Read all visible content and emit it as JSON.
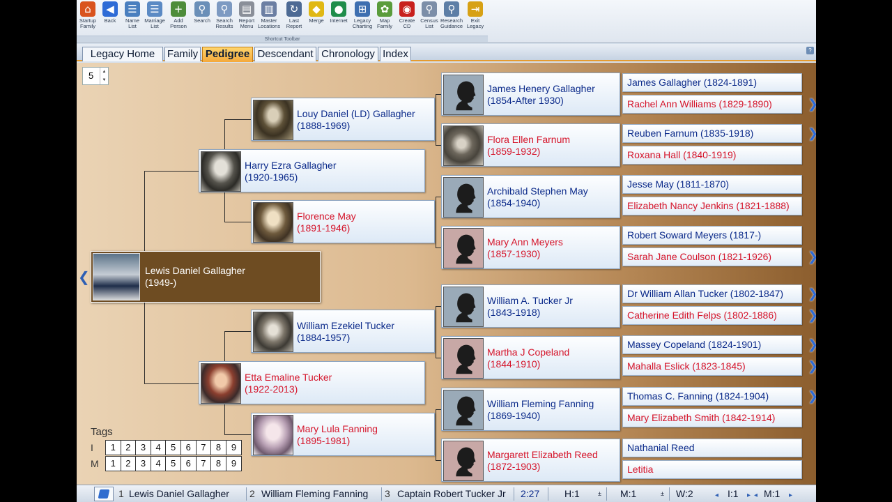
{
  "toolbar": {
    "caption": "Shortcut Toolbar",
    "tools": [
      {
        "label": "Startup\nFamily",
        "icon": "house-icon",
        "glyph": "⌂",
        "color": "#d9531e"
      },
      {
        "label": "Back",
        "icon": "back-arrow-icon",
        "glyph": "◀",
        "color": "#2e6bd6"
      },
      {
        "label": "Name\nList",
        "icon": "name-list-icon",
        "glyph": "☰",
        "color": "#4a7fbf"
      },
      {
        "label": "Marriage\nList",
        "icon": "marriage-list-icon",
        "glyph": "☰",
        "color": "#5b8ac4"
      },
      {
        "label": "Add\nPerson",
        "icon": "add-person-icon",
        "glyph": "+",
        "color": "#4d8c3a"
      },
      {
        "label": "Search",
        "icon": "search-icon",
        "glyph": "⚲",
        "color": "#6a8fb8"
      },
      {
        "label": "Search\nResults",
        "icon": "search-results-icon",
        "glyph": "⚲",
        "color": "#7d9ac2"
      },
      {
        "label": "Report\nMenu",
        "icon": "report-menu-icon",
        "glyph": "▤",
        "color": "#8a8f99"
      },
      {
        "label": "Master\nLocations",
        "icon": "master-locations-icon",
        "glyph": "▥",
        "color": "#6c7fa3"
      },
      {
        "label": "Last\nReport",
        "icon": "last-report-icon",
        "glyph": "↻",
        "color": "#4d6a94"
      },
      {
        "label": "Merge",
        "icon": "merge-icon",
        "glyph": "◆",
        "color": "#e0b814"
      },
      {
        "label": "Internet",
        "icon": "globe-icon",
        "glyph": "●",
        "color": "#1f8d4b"
      },
      {
        "label": "Legacy\nCharting",
        "icon": "charting-icon",
        "glyph": "⊞",
        "color": "#3e6fb0"
      },
      {
        "label": "Map\nFamily",
        "icon": "map-family-icon",
        "glyph": "✿",
        "color": "#5a9c3c"
      },
      {
        "label": "Create\nCD",
        "icon": "create-cd-icon",
        "glyph": "◉",
        "color": "#c8201e"
      },
      {
        "label": "Census\nList",
        "icon": "census-list-icon",
        "glyph": "⚲",
        "color": "#7c8ea8"
      },
      {
        "label": "Research\nGuidance",
        "icon": "research-guidance-icon",
        "glyph": "⚲",
        "color": "#5d7ea6"
      },
      {
        "label": "Exit\nLegacy",
        "icon": "exit-icon",
        "glyph": "⇥",
        "color": "#d7a115"
      }
    ]
  },
  "tabs": [
    "Legacy Home",
    "Family",
    "Pedigree",
    "Descendant",
    "Chronology",
    "Index"
  ],
  "active_tab": "Pedigree",
  "generations": "5",
  "root": {
    "name": "Lewis Daniel Gallagher",
    "dates": "(1949-)"
  },
  "parents": [
    {
      "name": "Harry Ezra Gallagher",
      "dates": "(1920-1965)",
      "sex": "male"
    },
    {
      "name": "Etta Emaline Tucker",
      "dates": "(1922-2013)",
      "sex": "female"
    }
  ],
  "grandparents": [
    {
      "name": "Louy Daniel (LD) Gallagher",
      "dates": "(1888-1969)",
      "sex": "male"
    },
    {
      "name": "Florence May",
      "dates": "(1891-1946)",
      "sex": "female"
    },
    {
      "name": "William Ezekiel Tucker",
      "dates": "(1884-1957)",
      "sex": "male"
    },
    {
      "name": "Mary Lula Fanning",
      "dates": "(1895-1981)",
      "sex": "female"
    }
  ],
  "great_grandparents": [
    {
      "name": "James Henery Gallagher",
      "dates": "(1854-After 1930)",
      "sex": "male"
    },
    {
      "name": "Flora Ellen Farnum",
      "dates": "(1859-1932)",
      "sex": "female"
    },
    {
      "name": "Archibald Stephen May",
      "dates": "(1854-1940)",
      "sex": "male"
    },
    {
      "name": "Mary Ann Meyers",
      "dates": "(1857-1930)",
      "sex": "female"
    },
    {
      "name": "William A. Tucker Jr",
      "dates": "(1843-1918)",
      "sex": "male"
    },
    {
      "name": "Martha J Copeland",
      "dates": "(1844-1910)",
      "sex": "female"
    },
    {
      "name": "William Fleming Fanning",
      "dates": "(1869-1940)",
      "sex": "male"
    },
    {
      "name": "Margarett Elizabeth Reed",
      "dates": "(1872-1903)",
      "sex": "female"
    }
  ],
  "gg_grandparents": [
    {
      "label": "James Gallagher (1824-1891)",
      "sex": "male"
    },
    {
      "label": "Rachel Ann Williams (1829-1890)",
      "sex": "female"
    },
    {
      "label": "Reuben Farnum (1835-1918)",
      "sex": "male"
    },
    {
      "label": "Roxana Hall (1840-1919)",
      "sex": "female"
    },
    {
      "label": "Jesse May (1811-1870)",
      "sex": "male"
    },
    {
      "label": "Elizabeth Nancy Jenkins (1821-1888)",
      "sex": "female"
    },
    {
      "label": "Robert Soward Meyers (1817-)",
      "sex": "male"
    },
    {
      "label": "Sarah Jane Coulson (1821-1926)",
      "sex": "female"
    },
    {
      "label": "Dr William Allan Tucker (1802-1847)",
      "sex": "male"
    },
    {
      "label": "Catherine Edith Felps (1802-1886)",
      "sex": "female"
    },
    {
      "label": "Massey Copeland (1824-1901)",
      "sex": "male"
    },
    {
      "label": "Mahalla Eslick (1823-1845)",
      "sex": "female"
    },
    {
      "label": "Thomas C. Fanning (1824-1904)",
      "sex": "male"
    },
    {
      "label": "Mary Elizabeth Smith (1842-1914)",
      "sex": "female"
    },
    {
      "label": "Nathanial Reed",
      "sex": "male"
    },
    {
      "label": "Letitia",
      "sex": "female"
    }
  ],
  "more_ancestors_icon": "chevron-right-icon",
  "tags": {
    "label": "Tags",
    "rows": [
      {
        "label": "I",
        "cells": [
          "1",
          "2",
          "3",
          "4",
          "5",
          "6",
          "7",
          "8",
          "9"
        ]
      },
      {
        "label": "M",
        "cells": [
          "1",
          "2",
          "3",
          "4",
          "5",
          "6",
          "7",
          "8",
          "9"
        ]
      }
    ]
  },
  "statusbar": {
    "bookmarks": [
      {
        "num": "1",
        "name": "Lewis Daniel Gallagher"
      },
      {
        "num": "2",
        "name": "William Fleming Fanning"
      },
      {
        "num": "3",
        "name": "Captain Robert Tucker Jr"
      }
    ],
    "time": "2:27",
    "h": "H:1",
    "m": "M:1",
    "w": "W:2",
    "i": "I:1",
    "m2": "M:1"
  },
  "colors": {
    "male": "#0b2a8a",
    "female": "#d5142a",
    "active_tab": "#f4a83b",
    "root_card": "#6e4c22"
  }
}
